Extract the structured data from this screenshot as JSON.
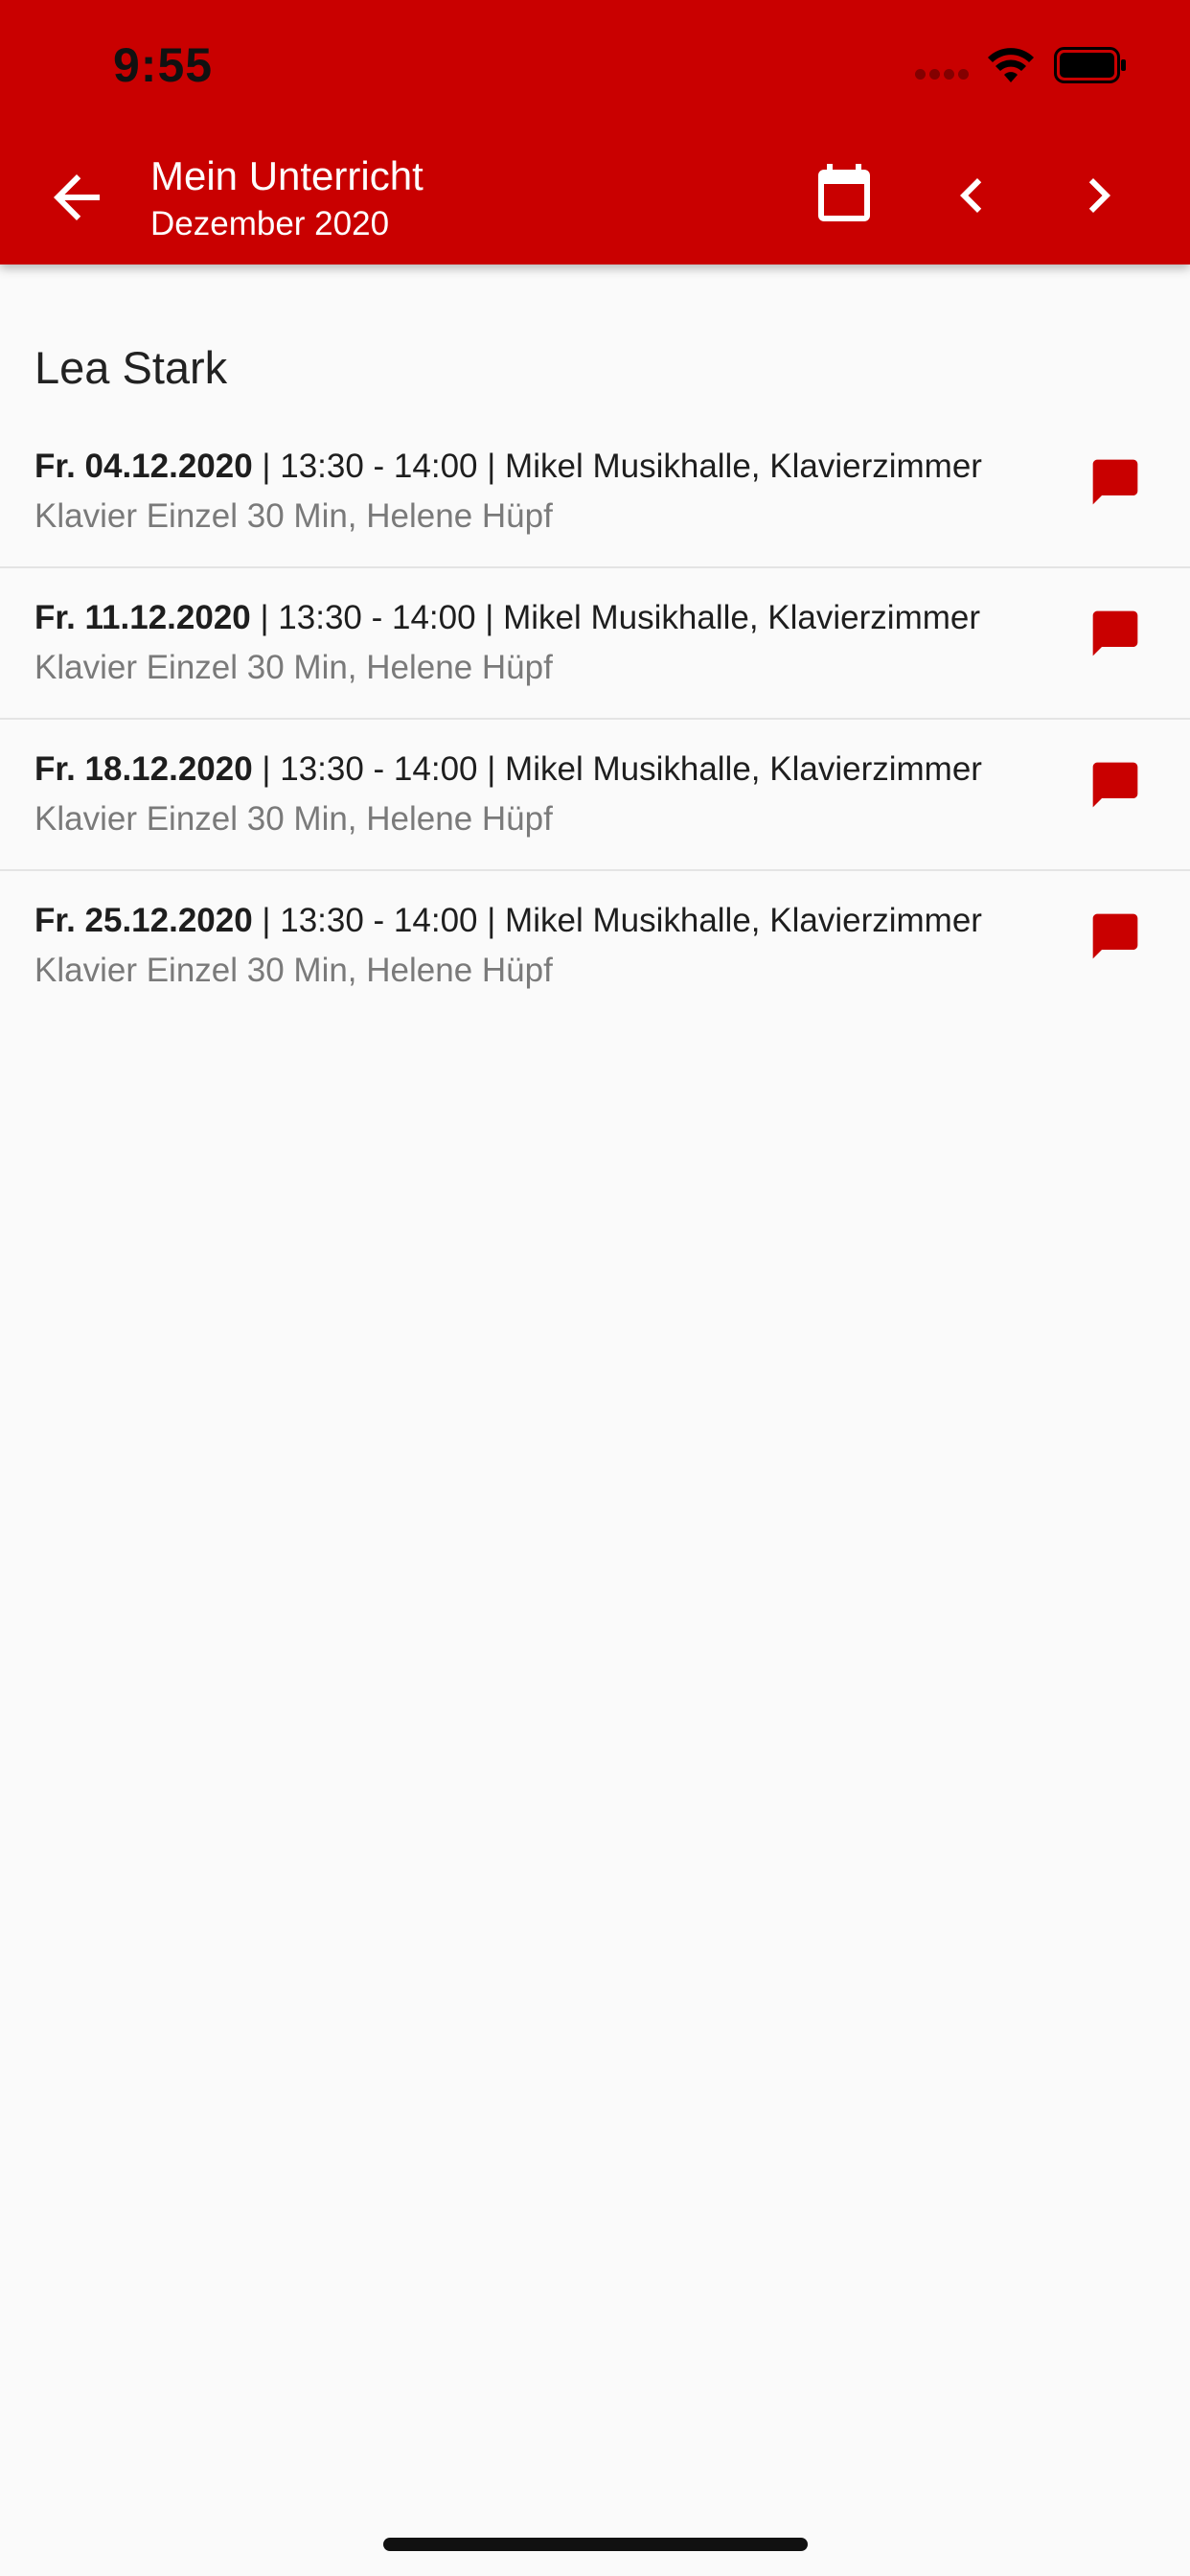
{
  "status_bar": {
    "time": "9:55"
  },
  "app_bar": {
    "title": "Mein Unterricht",
    "subtitle": "Dezember 2020"
  },
  "icons": {
    "back": "arrow-back-icon",
    "calendar": "calendar-icon",
    "prev": "chevron-left-icon",
    "next": "chevron-right-icon",
    "comment": "comment-icon"
  },
  "colors": {
    "primary": "#c90000",
    "background": "#fafafa",
    "text_primary": "#1e1e1e",
    "text_secondary": "#7a7a7a"
  },
  "student": {
    "name": "Lea Stark"
  },
  "lessons": [
    {
      "date": "Fr. 04.12.2020",
      "details": " | 13:30 - 14:00 | Mikel Musikhalle, Klavierzimmer",
      "description": "Klavier Einzel 30 Min, Helene Hüpf"
    },
    {
      "date": "Fr. 11.12.2020",
      "details": " | 13:30 - 14:00 | Mikel Musikhalle, Klavierzimmer",
      "description": "Klavier Einzel 30 Min, Helene Hüpf"
    },
    {
      "date": "Fr. 18.12.2020",
      "details": " | 13:30 - 14:00 | Mikel Musikhalle, Klavierzimmer",
      "description": "Klavier Einzel 30 Min, Helene Hüpf"
    },
    {
      "date": "Fr. 25.12.2020",
      "details": " | 13:30 - 14:00 | Mikel Musikhalle, Klavierzimmer",
      "description": "Klavier Einzel 30 Min, Helene Hüpf"
    }
  ]
}
